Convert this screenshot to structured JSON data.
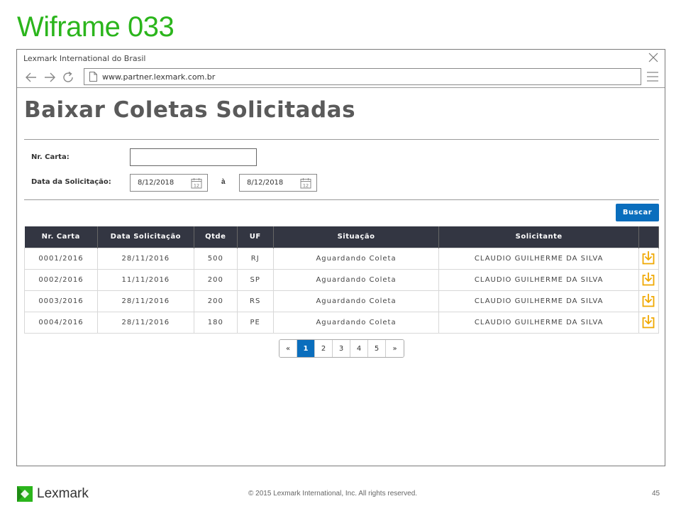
{
  "slide": {
    "title": "Wiframe 033",
    "copyright": "© 2015 Lexmark International, Inc. All rights reserved.",
    "page_number": "45",
    "logo_text": "Lexmark",
    "accent_color": "#2bb51c"
  },
  "browser": {
    "window_title": "Lexmark International do Brasil",
    "url": "www.partner.lexmark.com.br"
  },
  "page": {
    "heading": "Baixar Coletas Solicitadas",
    "form": {
      "nr_carta_label": "Nr. Carta:",
      "nr_carta_value": "",
      "data_label": "Data da Solicitação:",
      "date_from": "8/12/2018",
      "date_sep": "à",
      "date_to": "8/12/2018",
      "calendar_day": "12"
    },
    "search_button": "Buscar",
    "table": {
      "headers": [
        "Nr. Carta",
        "Data Solicitação",
        "Qtde",
        "UF",
        "Situação",
        "Solicitante",
        ""
      ],
      "rows": [
        [
          "0001/2016",
          "28/11/2016",
          "500",
          "RJ",
          "Aguardando Coleta",
          "CLAUDIO GUILHERME DA SILVA"
        ],
        [
          "0002/2016",
          "11/11/2016",
          "200",
          "SP",
          "Aguardando Coleta",
          "CLAUDIO GUILHERME DA SILVA"
        ],
        [
          "0003/2016",
          "28/11/2016",
          "200",
          "RS",
          "Aguardando Coleta",
          "CLAUDIO GUILHERME DA SILVA"
        ],
        [
          "0004/2016",
          "28/11/2016",
          "180",
          "PE",
          "Aguardando Coleta",
          "CLAUDIO GUILHERME DA SILVA"
        ]
      ],
      "row_icon": "download-icon",
      "icon_color": "#f0a800"
    },
    "pagination": [
      "«",
      "1",
      "2",
      "3",
      "4",
      "5",
      "»"
    ],
    "pagination_active": "1",
    "primary_color": "#0a6ebd"
  }
}
